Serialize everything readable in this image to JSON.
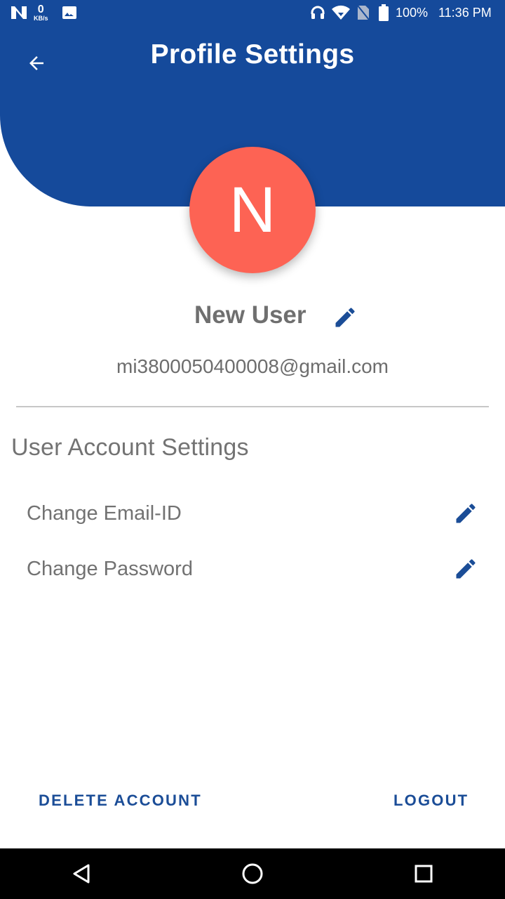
{
  "status_bar": {
    "kbs_value": "0",
    "kbs_unit": "KB/s",
    "battery": "100%",
    "time": "11:36 PM",
    "icons": [
      "n-notification-icon",
      "image-icon",
      "headphones-icon",
      "wifi-icon",
      "no-sim-icon",
      "battery-icon"
    ]
  },
  "header": {
    "title": "Profile Settings",
    "back_icon": "arrow-left-icon",
    "color": "#154a9b"
  },
  "profile": {
    "avatar_letter": "N",
    "avatar_color": "#fd6354",
    "name": "New User",
    "email": "mi3800050400008@gmail.com"
  },
  "account_settings": {
    "title": "User Account Settings",
    "items": [
      {
        "label": "Change Email-ID",
        "icon": "pencil-icon"
      },
      {
        "label": "Change Password",
        "icon": "pencil-icon"
      }
    ]
  },
  "actions": {
    "delete_label": "DELETE ACCOUNT",
    "logout_label": "LOGOUT",
    "color": "#1b4d97"
  },
  "nav": {
    "icons": [
      "back-triangle-icon",
      "home-circle-icon",
      "recents-square-icon"
    ]
  }
}
